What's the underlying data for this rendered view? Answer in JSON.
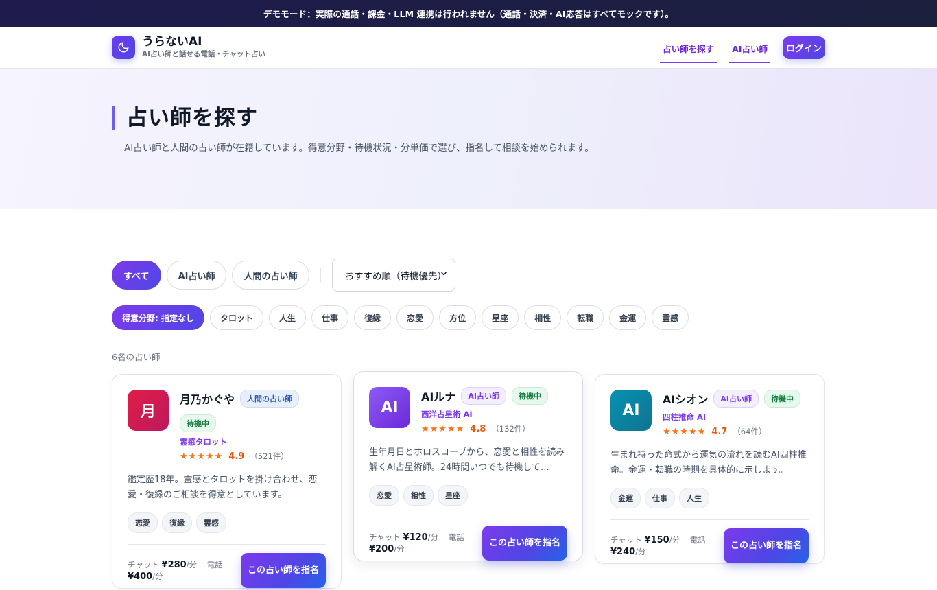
{
  "banner": {
    "text": "デモモード：実際の通話・課金・LLM 連携は行われません（通話・決済・AI応答はすべてモックです）。"
  },
  "header": {
    "brand_name": "うらないAI",
    "brand_tagline": "AI占い師と話せる電話・チャット占い",
    "nav": [
      {
        "label": "占い師を探す"
      },
      {
        "label": "AI占い師"
      }
    ],
    "login_label": "ログイン"
  },
  "hero": {
    "title": "占い師を探す",
    "description": "AI占い師と人間の占い師が在籍しています。得意分野・待機状況・分単価で選び、指名して相談を始められます。"
  },
  "filters": {
    "types": [
      {
        "label": "すべて",
        "active": true
      },
      {
        "label": "AI占い師",
        "active": false
      },
      {
        "label": "人間の占い師",
        "active": false
      }
    ],
    "sort_value": "おすすめ順（待機優先）",
    "specialties": [
      {
        "label": "得意分野: 指定なし",
        "active": true
      },
      {
        "label": "タロット"
      },
      {
        "label": "人生"
      },
      {
        "label": "仕事"
      },
      {
        "label": "復縁"
      },
      {
        "label": "恋愛"
      },
      {
        "label": "方位"
      },
      {
        "label": "星座"
      },
      {
        "label": "相性"
      },
      {
        "label": "転職"
      },
      {
        "label": "金運"
      },
      {
        "label": "霊感"
      }
    ]
  },
  "results": {
    "count_label": "6名の占い師",
    "cards": [
      {
        "avatar_text": "月",
        "avatar_color": "#be185d",
        "name": "月乃かぐや",
        "type_badge": "人間の占い師",
        "status": "待機中",
        "specialty": "霊感タロット",
        "stars": "★★★★★",
        "rating": "4.9",
        "reviews": "（521件）",
        "description": "鑑定歴18年。霊感とタロットを掛け合わせ、恋愛・復縁のご相談を得意としています。",
        "tags": [
          "恋愛",
          "復縁",
          "霊感"
        ],
        "chat_label": "チャット",
        "chat_price": "¥280",
        "per_min": "/分",
        "phone_label": "電話",
        "phone_price": "¥400",
        "button": "この占い師を指名"
      },
      {
        "avatar_text": "AI",
        "avatar_color": "#7c3aed",
        "name": "AIルナ",
        "type_badge": "AI占い師",
        "status": "待機中",
        "specialty": "西洋占星術 AI",
        "stars": "★★★★★",
        "rating": "4.8",
        "reviews": "（132件）",
        "description": "生年月日とホロスコープから、恋愛と相性を読み解くAI占星術師。24時間いつでも待機して…",
        "tags": [
          "恋愛",
          "相性",
          "星座"
        ],
        "chat_label": "チャット",
        "chat_price": "¥120",
        "per_min": "/分",
        "phone_label": "電話",
        "phone_price": "¥200",
        "button": "この占い師を指名"
      },
      {
        "avatar_text": "AI",
        "avatar_color": "#0e7490",
        "name": "AIシオン",
        "type_badge": "AI占い師",
        "status": "待機中",
        "specialty": "四柱推命 AI",
        "stars": "★★★★★",
        "rating": "4.7",
        "reviews": "（64件）",
        "description": "生まれ持った命式から運気の流れを読むAI四柱推命。金運・転職の時期を具体的に示します。",
        "tags": [
          "金運",
          "仕事",
          "人生"
        ],
        "chat_label": "チャット",
        "chat_price": "¥150",
        "per_min": "/分",
        "phone_label": "電話",
        "phone_price": "¥240",
        "button": "この占い師を指名"
      }
    ]
  }
}
